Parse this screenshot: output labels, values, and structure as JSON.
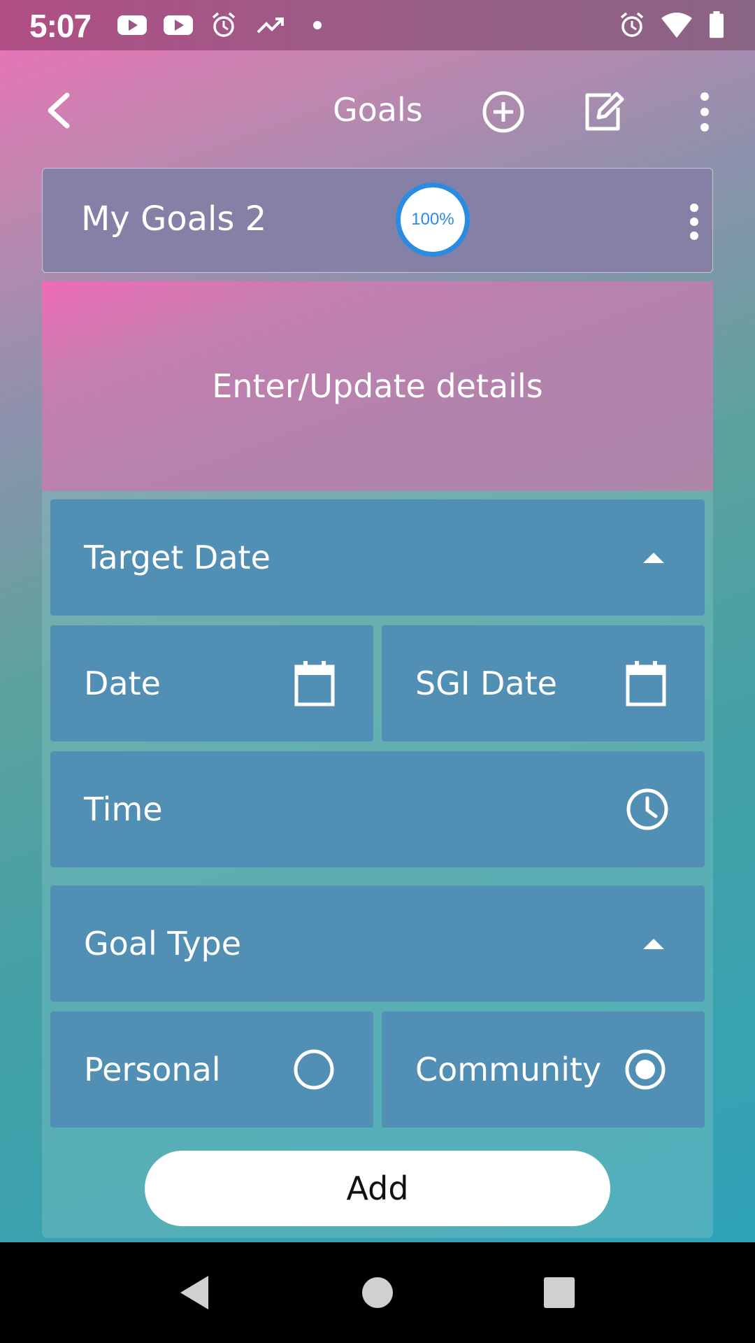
{
  "status_bar": {
    "time": "5:07",
    "left_icons": [
      "youtube-icon",
      "youtube-icon",
      "alarm-icon",
      "trending-icon",
      "dot-icon"
    ],
    "right_icons": [
      "alarm-icon",
      "wifi-icon",
      "battery-icon"
    ]
  },
  "toolbar": {
    "title": "Goals",
    "icons": [
      "back-arrow-icon",
      "add-circle-icon",
      "edit-icon",
      "more-vert-icon"
    ]
  },
  "goal_card": {
    "name": "My Goals 2",
    "progress_label": "100%",
    "progress": 1.0
  },
  "details_banner": {
    "text": "Enter/Update details"
  },
  "form": {
    "target_date": {
      "label": "Target Date",
      "expanded": true
    },
    "date": {
      "label": "Date"
    },
    "sgi_date": {
      "label": "SGI Date"
    },
    "time": {
      "label": "Time"
    },
    "goal_type": {
      "label": "Goal Type",
      "expanded": true
    },
    "personal": {
      "label": "Personal",
      "selected": false
    },
    "community": {
      "label": "Community",
      "selected": true
    },
    "add_label": "Add"
  },
  "colors": {
    "row_bg": "#528fb5",
    "progress_accent": "#2a8be0",
    "card_bg": "#8581a6"
  }
}
